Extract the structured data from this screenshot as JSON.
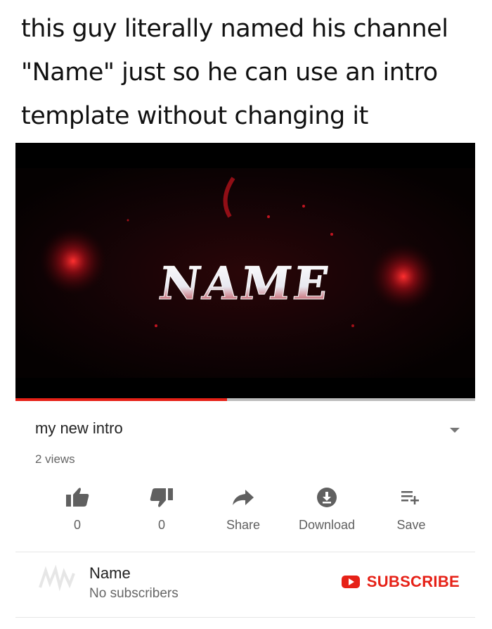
{
  "caption": {
    "line1": "this guy literally named his channel",
    "line2": "\"Name\" just so he can use an intro",
    "line3": "template without changing it"
  },
  "video": {
    "overlay_text": "NAME",
    "progress": 0.46,
    "progress_color": "#e62117"
  },
  "video_info": {
    "title": "my new intro",
    "views": "2 views",
    "expand_icon": "chevron-down-icon"
  },
  "actions": [
    {
      "icon": "thumbs-up-icon",
      "label": "0"
    },
    {
      "icon": "thumbs-down-icon",
      "label": "0"
    },
    {
      "icon": "share-icon",
      "label": "Share"
    },
    {
      "icon": "download-icon",
      "label": "Download"
    },
    {
      "icon": "add-to-playlist-icon",
      "label": "Save"
    }
  ],
  "channel": {
    "name": "Name",
    "subscribers": "No subscribers",
    "subscribe_label": "SUBSCRIBE",
    "accent": "#e62117"
  }
}
